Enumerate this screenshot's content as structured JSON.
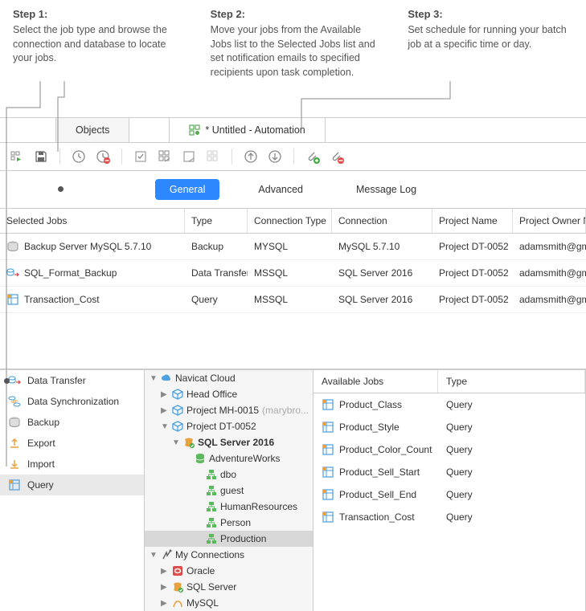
{
  "steps": [
    {
      "title": "Step 1:",
      "desc": "Select the job type and browse the connection and database to locate your jobs."
    },
    {
      "title": "Step 2:",
      "desc": "Move your jobs from the Available Jobs list to the Selected Jobs list and set notification emails to specified recipients upon task completion."
    },
    {
      "title": "Step 3:",
      "desc": "Set schedule for running your batch job at a specific time or day."
    }
  ],
  "tabs": {
    "objects": "Objects",
    "automation": "* Untitled - Automation"
  },
  "subtabs": {
    "general": "General",
    "advanced": "Advanced",
    "messagelog": "Message Log"
  },
  "grid": {
    "headers": {
      "c1": "Selected Jobs",
      "c2": "Type",
      "c3": "Connection Type",
      "c4": "Connection",
      "c5": "Project Name",
      "c6": "Project Owner N"
    },
    "rows": [
      {
        "icon": "backup",
        "c1": "Backup Server MySQL 5.7.10",
        "c2": "Backup",
        "c3": "MYSQL",
        "c4": "MySQL 5.7.10",
        "c5": "Project DT-0052",
        "c6": "adamsmith@gma"
      },
      {
        "icon": "datatransfer",
        "c1": "SQL_Format_Backup",
        "c2": "Data Transfer",
        "c3": "MSSQL",
        "c4": "SQL Server 2016",
        "c5": "Project DT-0052",
        "c6": "adamsmith@gma"
      },
      {
        "icon": "query",
        "c1": "Transaction_Cost",
        "c2": "Query",
        "c3": "MSSQL",
        "c4": "SQL Server 2016",
        "c5": "Project DT-0052",
        "c6": "adamsmith@gma"
      }
    ]
  },
  "sidebar": [
    {
      "icon": "datatransfer",
      "label": "Data Transfer",
      "sel": false
    },
    {
      "icon": "datasync",
      "label": "Data Synchronization",
      "sel": false
    },
    {
      "icon": "backup",
      "label": "Backup",
      "sel": false
    },
    {
      "icon": "export",
      "label": "Export",
      "sel": false
    },
    {
      "icon": "import",
      "label": "Import",
      "sel": false
    },
    {
      "icon": "query",
      "label": "Query",
      "sel": true
    }
  ],
  "tree": [
    {
      "d": 0,
      "arrow": "down",
      "icon": "cloud",
      "label": "Navicat Cloud",
      "gray": ""
    },
    {
      "d": 1,
      "arrow": "right",
      "icon": "cube",
      "label": "Head Office",
      "gray": ""
    },
    {
      "d": 1,
      "arrow": "right",
      "icon": "cube",
      "label": "Project MH-0015",
      "gray": "(marybro..."
    },
    {
      "d": 1,
      "arrow": "down",
      "icon": "cube",
      "label": "Project DT-0052",
      "gray": ""
    },
    {
      "d": 2,
      "arrow": "down",
      "icon": "sqlserver",
      "label": "SQL Server 2016",
      "gray": "",
      "bold": true
    },
    {
      "d": 3,
      "arrow": "",
      "icon": "db",
      "label": "AdventureWorks",
      "gray": ""
    },
    {
      "d": 4,
      "arrow": "",
      "icon": "schema",
      "label": "dbo",
      "gray": ""
    },
    {
      "d": 4,
      "arrow": "",
      "icon": "schema",
      "label": "guest",
      "gray": ""
    },
    {
      "d": 4,
      "arrow": "",
      "icon": "schema",
      "label": "HumanResources",
      "gray": ""
    },
    {
      "d": 4,
      "arrow": "",
      "icon": "schema",
      "label": "Person",
      "gray": ""
    },
    {
      "d": 4,
      "arrow": "",
      "icon": "schema",
      "label": "Production",
      "gray": "",
      "sel": true
    },
    {
      "d": 0,
      "arrow": "down",
      "icon": "myconn",
      "label": "My Connections",
      "gray": ""
    },
    {
      "d": 1,
      "arrow": "right",
      "icon": "oracle",
      "label": "Oracle",
      "gray": ""
    },
    {
      "d": 1,
      "arrow": "right",
      "icon": "sqlserver",
      "label": "SQL Server",
      "gray": ""
    },
    {
      "d": 1,
      "arrow": "right",
      "icon": "mysql",
      "label": "MySQL",
      "gray": ""
    }
  ],
  "available": {
    "headers": {
      "h1": "Available Jobs",
      "h2": "Type"
    },
    "rows": [
      {
        "label": "Product_Class",
        "type": "Query"
      },
      {
        "label": "Product_Style",
        "type": "Query"
      },
      {
        "label": "Product_Color_Count",
        "type": "Query"
      },
      {
        "label": "Product_Sell_Start",
        "type": "Query"
      },
      {
        "label": "Product_Sell_End",
        "type": "Query"
      },
      {
        "label": "Transaction_Cost",
        "type": "Query"
      }
    ]
  },
  "icons": {
    "datatransfer": "#3a9bd9",
    "datasync": "#3a9bd9",
    "backup": "#888",
    "export": "#e9a13b",
    "import": "#e9a13b",
    "query": "#4a9de0",
    "cloud": "#4aa3e0",
    "cube": "#4aa3e0",
    "sqlserver": "#e9a13b",
    "db": "#5db85d",
    "schema": "#5db85d",
    "myconn": "#666",
    "oracle": "#e04a4a",
    "mysql": "#e9a13b"
  }
}
